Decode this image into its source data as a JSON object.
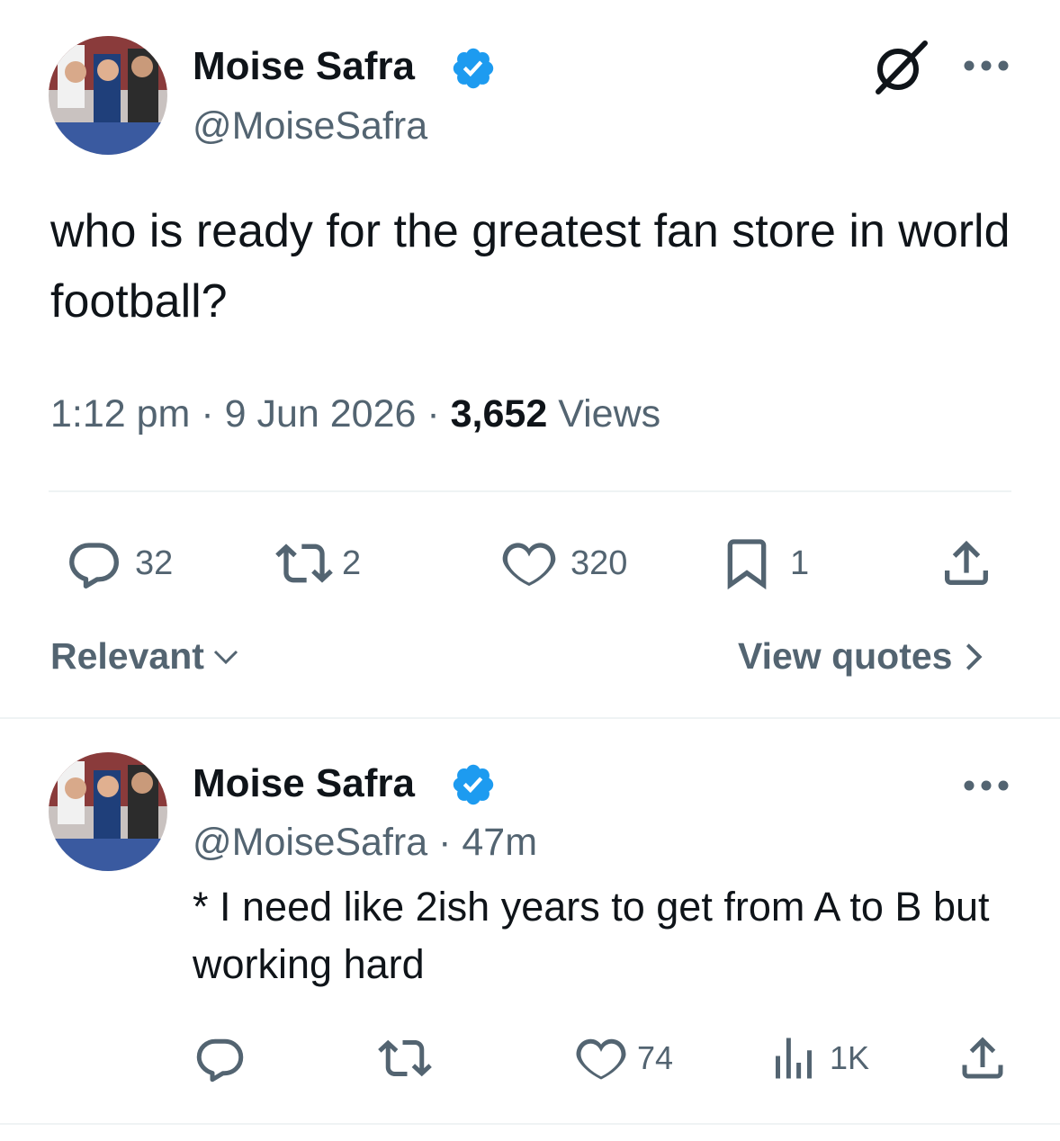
{
  "tweet": {
    "author_name": "Moise Safra",
    "author_handle": "@MoiseSafra",
    "text": "who is ready for the greatest fan store in world football?",
    "time": "1:12 pm",
    "sep": "·",
    "date": "9 Jun 2026",
    "views_count": "3,652",
    "views_label": "Views",
    "replies": "32",
    "reposts": "2",
    "likes": "320",
    "bookmarks": "1"
  },
  "sort": {
    "label": "Relevant",
    "quotes_label": "View quotes"
  },
  "reply": {
    "author_name": "Moise Safra",
    "author_handle": "@MoiseSafra",
    "sep": "·",
    "time_ago": "47m",
    "text": "* I need like 2ish years to get from A to B but working hard",
    "likes": "74",
    "views": "1K"
  },
  "colors": {
    "verified": "#1d9bf0",
    "secondary_text": "#536471",
    "primary_text": "#0f1419",
    "divider": "#eff3f4"
  },
  "icons": [
    "verified-badge-icon",
    "grok-icon",
    "more-icon",
    "reply-icon",
    "repost-icon",
    "like-icon",
    "bookmark-icon",
    "share-icon",
    "chevron-down-icon",
    "chevron-right-icon",
    "views-icon"
  ]
}
